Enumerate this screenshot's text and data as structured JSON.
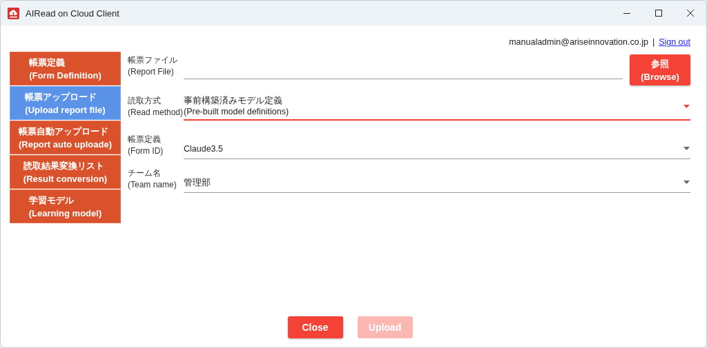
{
  "window": {
    "title": "AIRead on Cloud Client"
  },
  "user": {
    "email": "manualadmin@ariseinnovation.co.jp",
    "separator": "|",
    "sign_out": "Sign out"
  },
  "sidebar": {
    "items": [
      {
        "label_ja": "帳票定義",
        "label_en": "(Form Definition)",
        "selected": false
      },
      {
        "label_ja": "帳票アップロード",
        "label_en": "(Upload report file)",
        "selected": true
      },
      {
        "label_ja": "帳票自動アップロード",
        "label_en": "(Report auto uploade)",
        "selected": false
      },
      {
        "label_ja": "読取結果変換リスト",
        "label_en": "(Result conversion)",
        "selected": false
      },
      {
        "label_ja": "学習モデル",
        "label_en": "(Learning model)",
        "selected": false
      }
    ]
  },
  "form": {
    "fields": [
      {
        "kind": "file",
        "label_ja": "帳票ファイル",
        "label_en": "(Report File)",
        "focused": false,
        "button_ja": "参照",
        "button_en": "(Browse)"
      },
      {
        "kind": "select",
        "label_ja": "読取方式",
        "label_en": "(Read method)",
        "value_lines": [
          "事前構築済みモデル定義",
          "(Pre-built model definitions)"
        ],
        "focused": true
      },
      {
        "kind": "select",
        "label_ja": "帳票定義",
        "label_en": "(Form ID)",
        "value_lines": [
          "Claude3.5"
        ],
        "focused": false
      },
      {
        "kind": "select",
        "label_ja": "チーム名",
        "label_en": "(Team name)",
        "value_lines": [
          "管理部"
        ],
        "focused": false
      }
    ]
  },
  "buttons": [
    {
      "label": "Close",
      "disabled": false
    },
    {
      "label": "Upload",
      "disabled": true
    }
  ]
}
